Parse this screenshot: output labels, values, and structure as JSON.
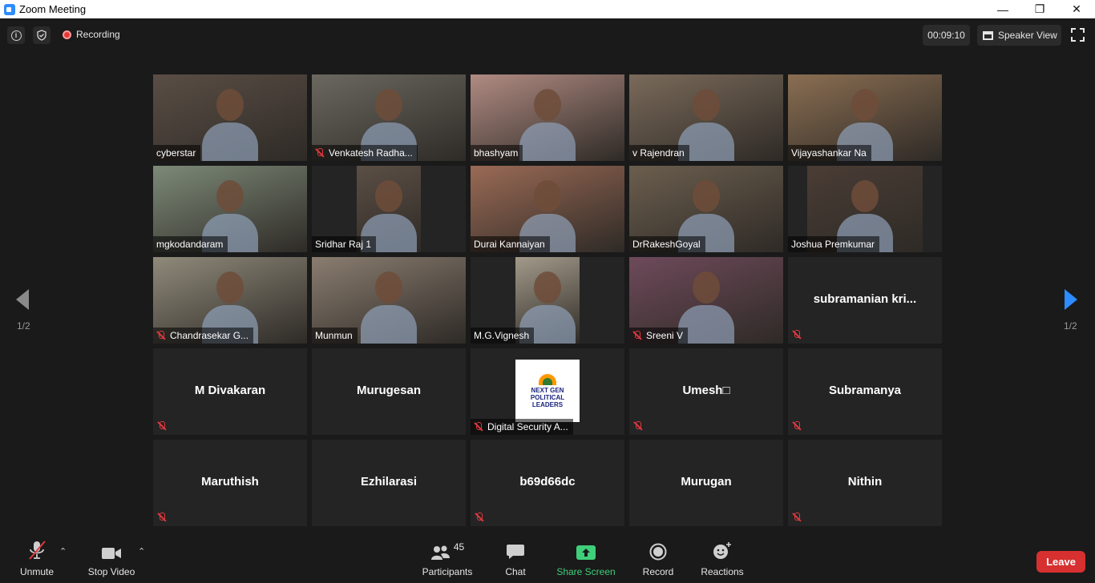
{
  "window": {
    "title": "Zoom Meeting",
    "minimize": "—",
    "restore": "❐",
    "close": "✕"
  },
  "topbar": {
    "recording_label": "Recording",
    "timer": "00:09:10",
    "view_label": "Speaker View"
  },
  "colors": {
    "background": "#1a1a1a",
    "tile": "#242424",
    "active_border": "#d6e66b",
    "mute_red": "#e0393e",
    "leave_red": "#d63030",
    "share_green": "#3fcf7a",
    "nav_blue": "#2d8cff"
  },
  "grid": {
    "tiles": [
      {
        "name": "cyberstar",
        "video": true,
        "muted": false,
        "bg": "#5a4e45"
      },
      {
        "name": "Venkatesh Radha...",
        "video": true,
        "muted": true,
        "bg": "#6b6860"
      },
      {
        "name": "bhashyam",
        "video": true,
        "muted": false,
        "bg": "#b08b82"
      },
      {
        "name": "v Rajendran",
        "video": true,
        "muted": false,
        "active": true,
        "bg": "#7a6a5a"
      },
      {
        "name": "Vijayashankar Na",
        "video": true,
        "muted": false,
        "bg": "#8a6e52"
      },
      {
        "name": "mgkodandaram",
        "video": true,
        "muted": false,
        "bg": "#7d8a78"
      },
      {
        "name": "Sridhar Raj 1",
        "video": true,
        "muted": false,
        "pillar": true,
        "bg": "#5b4f45"
      },
      {
        "name": "Durai Kannaiyan",
        "video": true,
        "muted": false,
        "bg": "#9a6a55"
      },
      {
        "name": "DrRakeshGoyal",
        "video": true,
        "muted": false,
        "bg": "#6b5e4e"
      },
      {
        "name": "Joshua Premkumar",
        "video": true,
        "muted": false,
        "pillar": true,
        "bg": "#4a3d35"
      },
      {
        "name": "Chandrasekar G...",
        "video": true,
        "muted": true,
        "bg": "#8f8a7a"
      },
      {
        "name": "Munmun",
        "video": true,
        "muted": false,
        "bg": "#8a7d70"
      },
      {
        "name": "M.G.Vignesh",
        "video": true,
        "muted": false,
        "pillar": true,
        "bg": "#a39a8a"
      },
      {
        "name": "Sreeni V",
        "video": true,
        "muted": true,
        "bg": "#6e4a5a"
      },
      {
        "name": "subramanian kri...",
        "video": false,
        "muted": true
      },
      {
        "name": "M Divakaran",
        "video": false,
        "muted": true
      },
      {
        "name": "Murugesan",
        "video": false,
        "muted": false
      },
      {
        "name": "Digital Security A...",
        "video": true,
        "muted": true,
        "logo": true
      },
      {
        "name": "Umesh□",
        "video": false,
        "muted": true
      },
      {
        "name": "Subramanya",
        "video": false,
        "muted": true
      },
      {
        "name": "Maruthish",
        "video": false,
        "muted": true
      },
      {
        "name": "Ezhilarasi",
        "video": false,
        "muted": false
      },
      {
        "name": "b69d66dc",
        "video": false,
        "muted": true
      },
      {
        "name": "Murugan",
        "video": false,
        "muted": false
      },
      {
        "name": "Nithin",
        "video": false,
        "muted": true
      }
    ],
    "logo_text": "NEXT GEN POLITICAL LEADERS"
  },
  "pagination": {
    "left": "1/2",
    "right": "1/2"
  },
  "toolbar": {
    "unmute": "Unmute",
    "stop_video": "Stop Video",
    "participants": "Participants",
    "participant_count": "45",
    "chat": "Chat",
    "share_screen": "Share Screen",
    "record": "Record",
    "reactions": "Reactions",
    "leave": "Leave"
  }
}
